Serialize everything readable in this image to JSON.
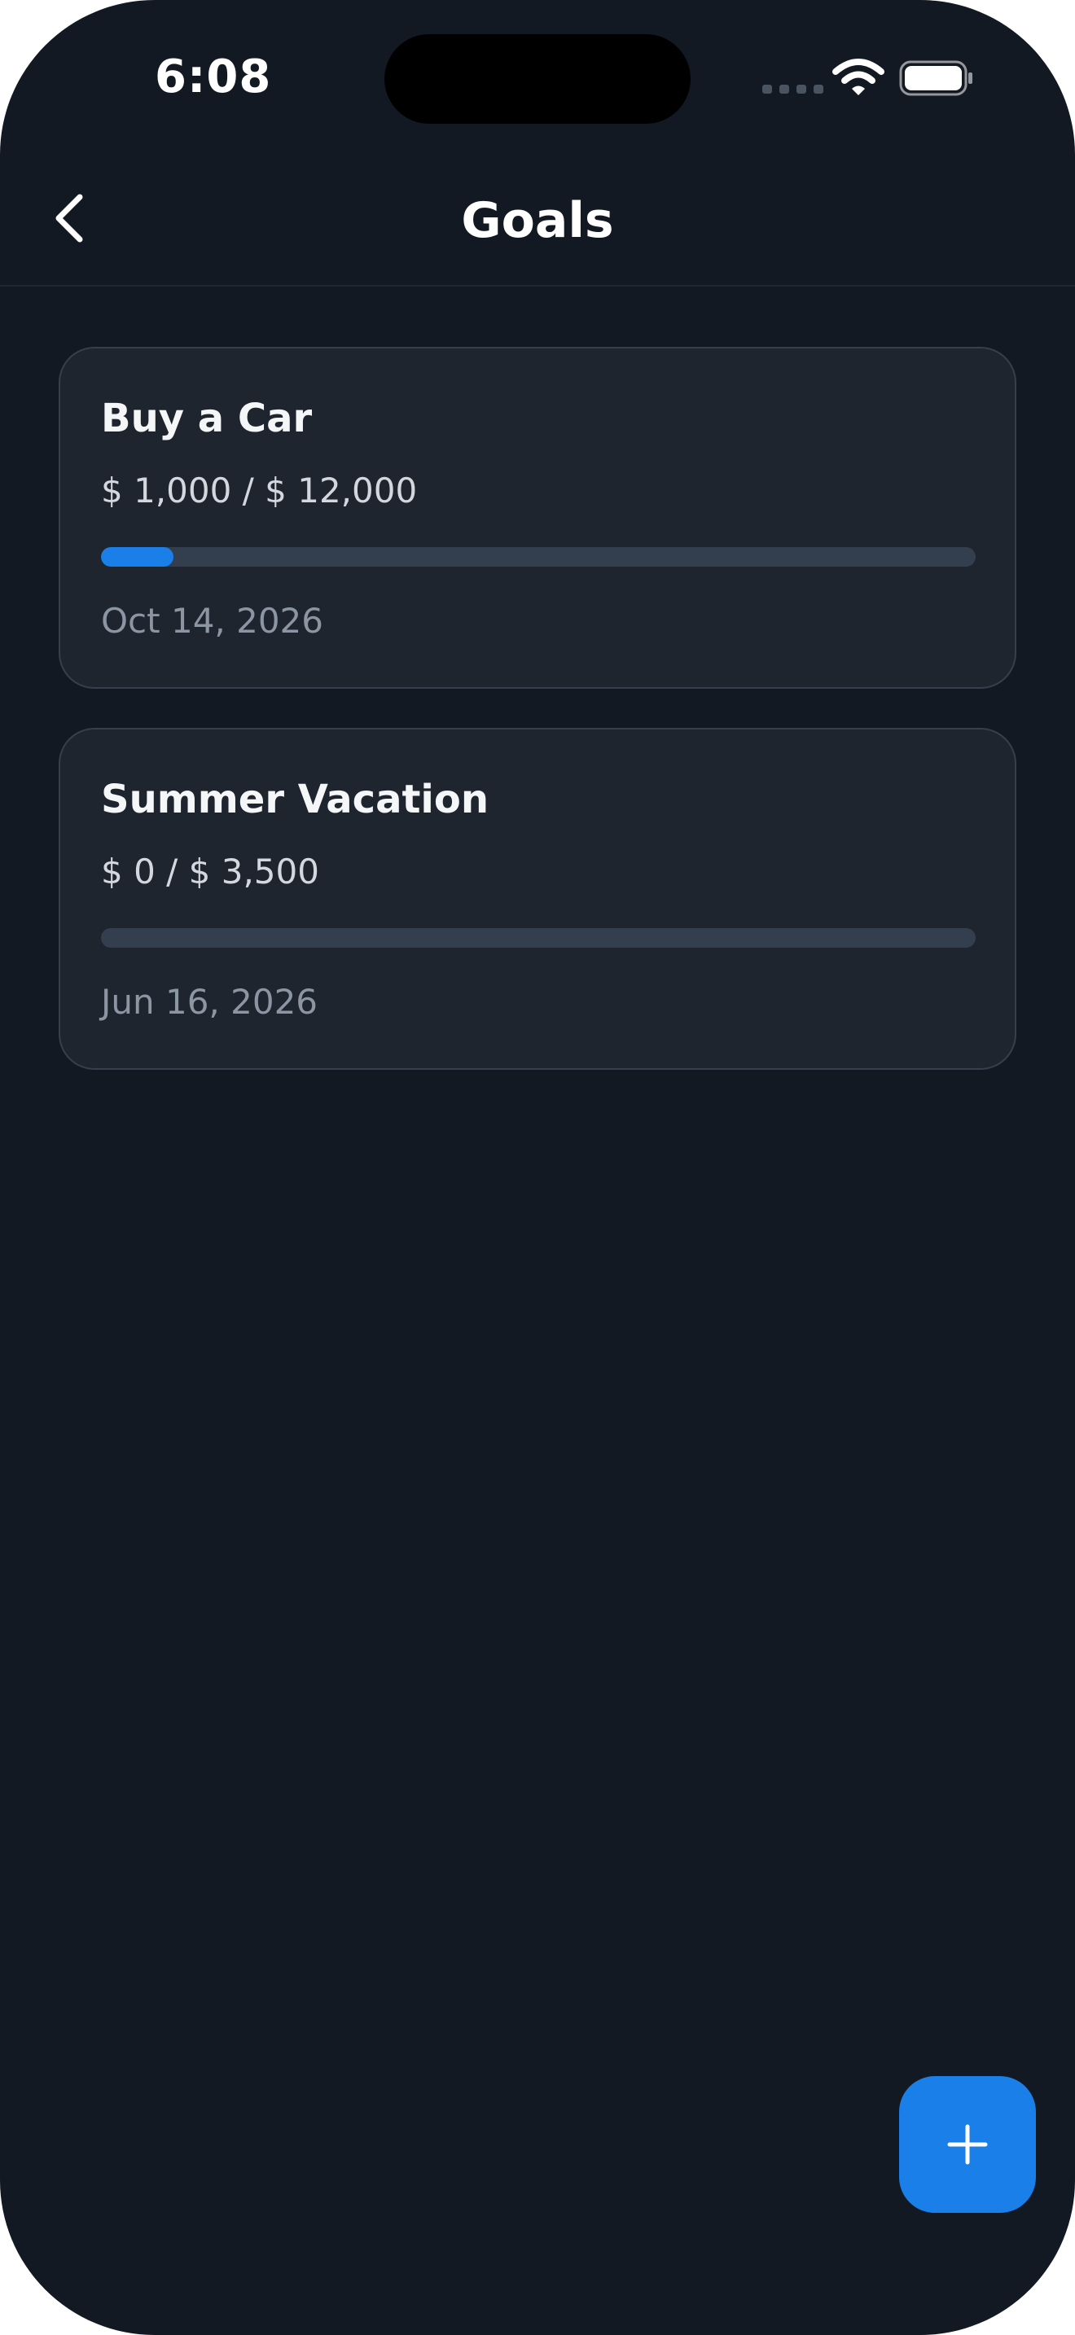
{
  "status_bar": {
    "time": "6:08"
  },
  "header": {
    "title": "Goals",
    "back_icon": "chevron-left-icon"
  },
  "goals": [
    {
      "name": "Buy a Car",
      "amount": "$ 1,000 / $ 12,000",
      "progress": 0.0833,
      "date": "Oct 14, 2026"
    },
    {
      "name": "Summer Vacation",
      "amount": "$ 0 / $ 3,500",
      "progress": 0,
      "date": "Jun 16, 2026"
    }
  ],
  "fab": {
    "icon": "plus-icon"
  },
  "colors": {
    "background": "#121922",
    "card": "#1e252f",
    "accent": "#1a7fe8",
    "track": "#333f4f"
  }
}
